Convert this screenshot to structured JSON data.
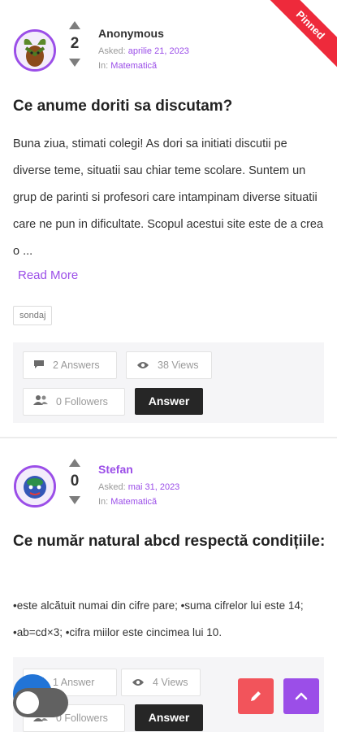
{
  "pinned_label": "Pinned",
  "questions": [
    {
      "author": "Anonymous",
      "votes": "2",
      "asked_label": "Asked:",
      "asked_date": "aprilie 21, 2023",
      "in_label": "In:",
      "category": "Matematică",
      "title": "Ce anume doriti sa discutam?",
      "body": "Buna ziua, stimati colegi! As dori sa initiati discutii pe diverse teme, situatii sau chiar teme scolare. Suntem un grup de parinti si profesori care intampinam diverse situatii care ne pun in dificultate. Scopul acestui site este de a crea o ...",
      "read_more": "Read More",
      "tag": "sondaj",
      "answers": "2 Answers",
      "views": "38 Views",
      "followers": "0 Followers",
      "answer_button": "Answer"
    },
    {
      "author": "Stefan",
      "votes": "0",
      "asked_label": "Asked:",
      "asked_date": "mai 31, 2023",
      "in_label": "In:",
      "category": "Matematică",
      "title": "Ce număr natural abcd respectă condițiile:",
      "body": "•este alcătuit numai din cifre pare; •suma cifrelor lui este 14; •ab=cd×3; •cifra miilor este cincimea lui 10.",
      "answers": "1 Answer",
      "views": "4 Views",
      "followers": "0 Followers",
      "answer_button": "Answer"
    }
  ],
  "colors": {
    "accent": "#9b4ee8",
    "pinned": "#ee2a3b",
    "edit_fab": "#f2545b",
    "answer_button": "#262626"
  },
  "icons": [
    "comment-icon",
    "eye-icon",
    "followers-icon",
    "pencil-icon",
    "chevron-up-icon"
  ]
}
